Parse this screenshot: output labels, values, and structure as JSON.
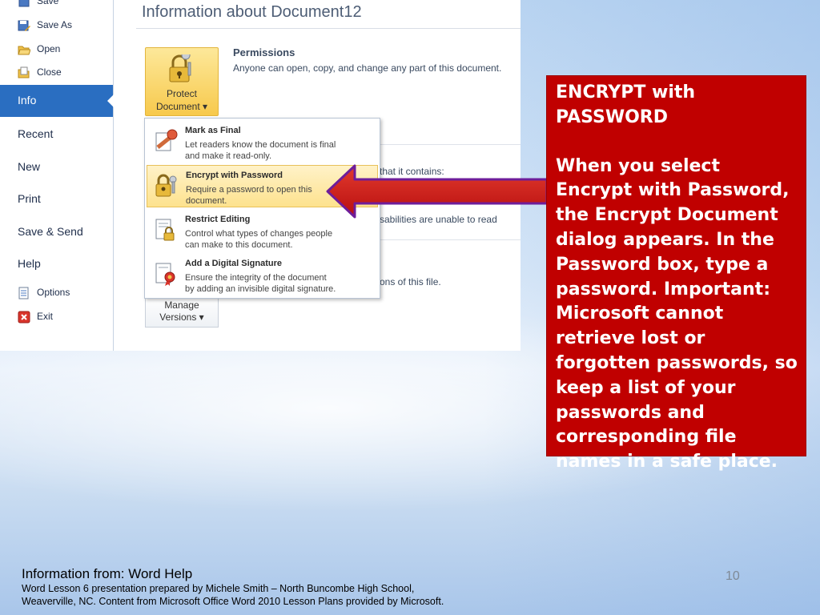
{
  "sidebar": {
    "items_small_top": [
      {
        "label": "Save",
        "icon": "save-icon"
      },
      {
        "label": "Save As",
        "icon": "save-as-icon"
      },
      {
        "label": "Open",
        "icon": "open-folder-icon"
      },
      {
        "label": "Close",
        "icon": "close-document-icon"
      }
    ],
    "active_item": "Info",
    "items_big": [
      "Recent",
      "New",
      "Print",
      "Save & Send",
      "Help"
    ],
    "items_small_bottom": [
      {
        "label": "Options",
        "icon": "options-icon"
      },
      {
        "label": "Exit",
        "icon": "exit-icon"
      }
    ]
  },
  "main": {
    "title": "Information about Document12",
    "protect_button": {
      "line1": "Protect",
      "line2": "Document ▾"
    },
    "permissions": {
      "heading": "Permissions",
      "text": "Anyone can open, copy, and change any part of this document."
    },
    "partial_lines": {
      "contains": "that it contains:",
      "read": "sabilities are unable to read",
      "versions": "ons of this file."
    },
    "manage_button": {
      "line1": "Manage",
      "line2": "Versions ▾"
    }
  },
  "menu": {
    "items": [
      {
        "title": "Mark as Final",
        "desc": "Let readers know the document is final\nand make it read-only.",
        "icon": "mark-final-icon",
        "highlighted": false
      },
      {
        "title": "Encrypt with Password",
        "desc": "Require a password to open this\ndocument.",
        "icon": "encrypt-lock-icon",
        "highlighted": true
      },
      {
        "title": "Restrict Editing",
        "desc": "Control what types of changes people\ncan make to this document.",
        "icon": "restrict-editing-icon",
        "highlighted": false
      },
      {
        "title": "Add a Digital Signature",
        "desc": "Ensure the integrity of the document\nby adding an invisible digital signature.",
        "icon": "digital-signature-icon",
        "highlighted": false
      }
    ]
  },
  "callout": {
    "heading": "ENCRYPT with\nPASSWORD",
    "body": "When you select Encrypt with Password, the Encrypt Document dialog appears. In the Password box, type a password. Important: Microsoft cannot retrieve lost or forgotten passwords, so keep a list of your passwords and corresponding file names in a safe place."
  },
  "footer": {
    "source": "Information from:  Word Help",
    "credit": "Word Lesson 6 presentation prepared by Michele Smith – North Buncombe High School,\nWeaverville, NC. Content from Microsoft Office Word 2010 Lesson Plans provided by Microsoft.",
    "page_number": "10"
  },
  "colors": {
    "accent_blue": "#2a6ec1",
    "callout_red": "#c00000",
    "highlight_gold": "#fde28e"
  }
}
